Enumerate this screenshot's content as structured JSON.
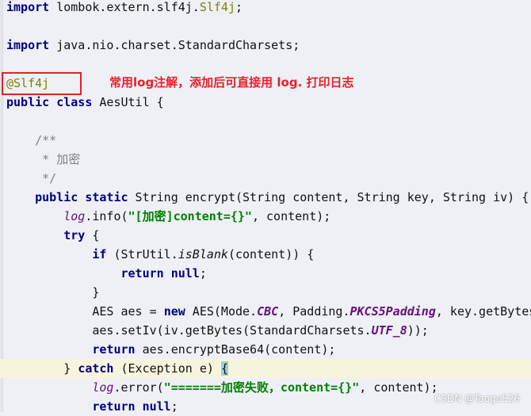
{
  "annotation": {
    "text": "常用log注解，添加后可直接用 log. 打印日志",
    "color": "#e8202a"
  },
  "watermark": "CSDN @Taoge526",
  "caret_line": 19,
  "lines": [
    [
      {
        "t": "import",
        "c": "kw"
      },
      {
        "t": " lombok.extern.slf4j."
      },
      {
        "t": "Slf4j",
        "c": "ann"
      },
      {
        "t": ";"
      }
    ],
    [],
    [
      {
        "t": "import",
        "c": "kw"
      },
      {
        "t": " java.nio.charset.StandardCharsets;"
      }
    ],
    [],
    [
      {
        "t": "@Slf4j",
        "c": "ann"
      }
    ],
    [
      {
        "t": "public class",
        "c": "kw"
      },
      {
        "t": " AesUtil {"
      }
    ],
    [],
    [
      {
        "t": "    /**",
        "c": "cmt"
      }
    ],
    [
      {
        "t": "     * 加密",
        "c": "cmt"
      }
    ],
    [
      {
        "t": "     */",
        "c": "cmt"
      }
    ],
    [
      {
        "t": "    "
      },
      {
        "t": "public static",
        "c": "kw"
      },
      {
        "t": " String encrypt(String content, String key, String iv) {"
      }
    ],
    [
      {
        "t": "        "
      },
      {
        "t": "log",
        "c": "log"
      },
      {
        "t": ".info("
      },
      {
        "t": "\"[加密]content={}\"",
        "c": "str"
      },
      {
        "t": ", content);"
      }
    ],
    [
      {
        "t": "        "
      },
      {
        "t": "try",
        "c": "kw"
      },
      {
        "t": " {"
      }
    ],
    [
      {
        "t": "            "
      },
      {
        "t": "if",
        "c": "kw"
      },
      {
        "t": " (StrUtil."
      },
      {
        "t": "isBlank",
        "c": "ital"
      },
      {
        "t": "(content)) {"
      }
    ],
    [
      {
        "t": "                "
      },
      {
        "t": "return null",
        "c": "kw"
      },
      {
        "t": ";"
      }
    ],
    [
      {
        "t": "            }"
      }
    ],
    [
      {
        "t": "            AES aes = "
      },
      {
        "t": "new",
        "c": "kw"
      },
      {
        "t": " AES(Mode."
      },
      {
        "t": "CBC",
        "c": "fld"
      },
      {
        "t": ", Padding."
      },
      {
        "t": "PKCS5Padding",
        "c": "fld"
      },
      {
        "t": ", key.getBytes("
      }
    ],
    [
      {
        "t": "            aes.setIv(iv.getBytes(StandardCharsets."
      },
      {
        "t": "UTF_8",
        "c": "fld"
      },
      {
        "t": "));"
      }
    ],
    [
      {
        "t": "            "
      },
      {
        "t": "return",
        "c": "kw"
      },
      {
        "t": " aes.encryptBase64(content);"
      }
    ],
    [
      {
        "t": "        } "
      },
      {
        "t": "catch",
        "c": "kw"
      },
      {
        "t": " (Exception e) "
      },
      {
        "t": "{",
        "c": "brace"
      }
    ],
    [
      {
        "t": "            "
      },
      {
        "t": "log",
        "c": "log"
      },
      {
        "t": ".error("
      },
      {
        "t": "\"=======加密失败，content={}\"",
        "c": "str"
      },
      {
        "t": ", content);"
      }
    ],
    [
      {
        "t": "            "
      },
      {
        "t": "return null",
        "c": "kw"
      },
      {
        "t": ";"
      }
    ]
  ]
}
